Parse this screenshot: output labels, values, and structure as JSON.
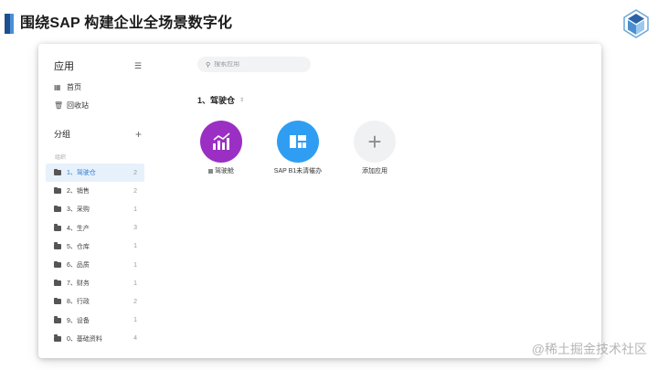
{
  "slide": {
    "title": "围绕SAP 构建企业全场景数字化",
    "watermark": "@稀土掘金技术社区"
  },
  "sidebar": {
    "title": "应用",
    "nav": [
      {
        "label": "首页",
        "icon": "grid-icon"
      },
      {
        "label": "回收站",
        "icon": "trash-icon"
      }
    ],
    "group_title": "分组",
    "org_label": "组织",
    "groups": [
      {
        "label": "1、驾驶仓",
        "count": "2",
        "active": true
      },
      {
        "label": "2、销售",
        "count": "2"
      },
      {
        "label": "3、采购",
        "count": "1"
      },
      {
        "label": "4、生产",
        "count": "3"
      },
      {
        "label": "5、仓库",
        "count": "1"
      },
      {
        "label": "6、品质",
        "count": "1"
      },
      {
        "label": "7、财务",
        "count": "1"
      },
      {
        "label": "8、行政",
        "count": "2"
      },
      {
        "label": "9、设备",
        "count": "1"
      },
      {
        "label": "0、基础资料",
        "count": "4"
      }
    ]
  },
  "main": {
    "search_placeholder": "搜索应用",
    "section_title": "1、驾驶仓",
    "apps": [
      {
        "label": "驾驶舱",
        "color": "#9b2fc4",
        "icon": "chart-icon"
      },
      {
        "label": "SAP B1未清催办",
        "color": "#2f9ef2",
        "icon": "dashboard-icon"
      },
      {
        "label": "添加应用",
        "color": "#f0f1f3",
        "icon": "plus-icon"
      }
    ]
  },
  "colors": {
    "accent": "#2d7bd3",
    "active_bg": "#e7f1fb",
    "title_bar_dark": "#1f4e8c",
    "title_bar_light": "#4a90d9"
  }
}
